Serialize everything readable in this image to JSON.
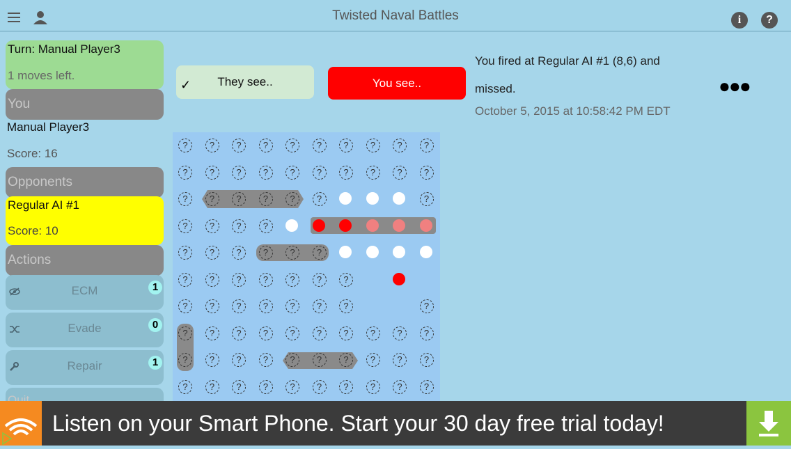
{
  "header": {
    "title": "Twisted Naval Battles",
    "menu_icon": "hamburger-icon",
    "user_icon": "user-icon",
    "info_icon": "info-icon",
    "help_icon": "help-icon"
  },
  "turn": {
    "title": "Turn: Manual Player3",
    "moves": "1 moves left."
  },
  "you": {
    "header": "You",
    "name": "Manual Player3",
    "score": "Score: 16"
  },
  "opponents": {
    "header": "Opponents",
    "name": "Regular AI #1",
    "score": "Score: 10"
  },
  "actions": {
    "header": "Actions",
    "items": [
      {
        "label": "ECM",
        "count": "1",
        "icon": "eye-slash-icon"
      },
      {
        "label": "Evade",
        "count": "0",
        "icon": "shuffle-icon"
      },
      {
        "label": "Repair",
        "count": "1",
        "icon": "wrench-icon"
      }
    ],
    "quit": "Quit"
  },
  "buttons": {
    "they_see": "They see..",
    "you_see": "You see.."
  },
  "message": {
    "text": "You fired at Regular AI #1 (8,6) and missed.",
    "time": "October 5, 2015 at 10:58:42 PM EDT"
  },
  "grid": {
    "unknown_glyph": "?",
    "cols": 10,
    "rows": 10
  },
  "ad": {
    "text": "Listen on your Smart Phone. Start your 30 day free trial today!"
  },
  "colors": {
    "you_see": "#ff0000",
    "they_see": "#d2ead3",
    "turn": "#9ddb93",
    "opponent": "#ffff00",
    "ad_download": "#8bc53f",
    "ad_logo": "#f58a20"
  }
}
